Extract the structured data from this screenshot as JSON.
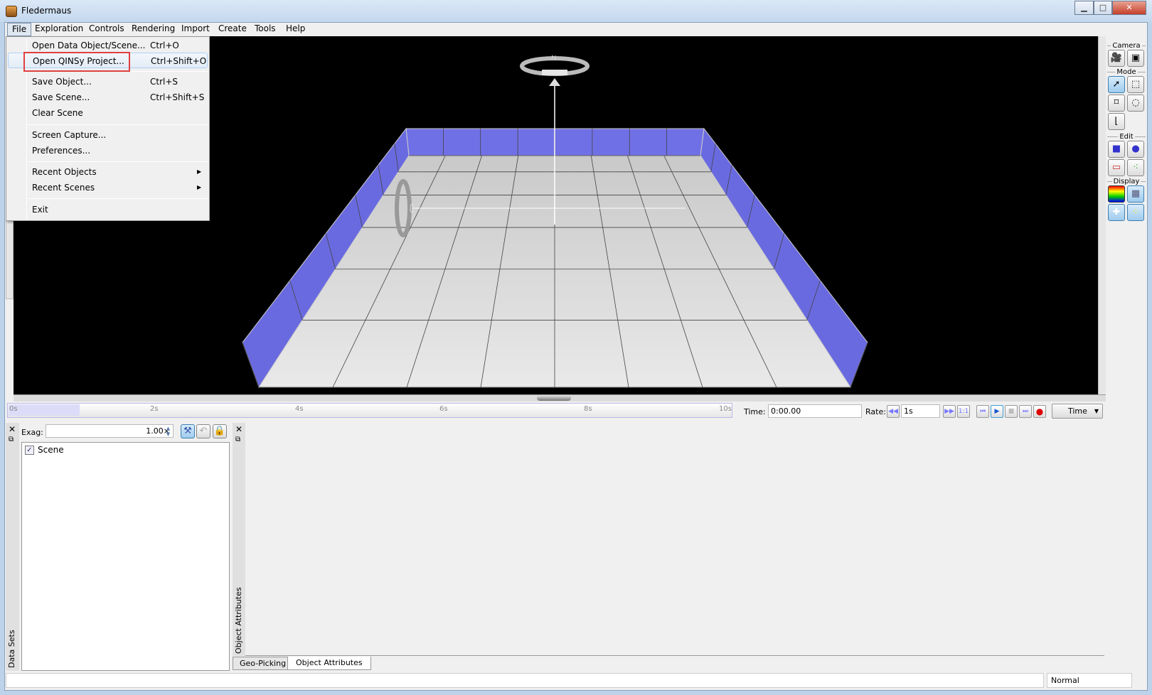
{
  "window": {
    "title": "Fledermaus",
    "min": "▁",
    "max": "□",
    "close": "✕"
  },
  "menubar": [
    "File",
    "Exploration",
    "Controls",
    "Rendering",
    "Import",
    "Create",
    "Tools",
    "Help"
  ],
  "file_menu": [
    {
      "label": "Open Data Object/Scene...",
      "shortcut": "Ctrl+O"
    },
    {
      "label": "Open QINSy Project...",
      "shortcut": "Ctrl+Shift+O"
    },
    {
      "label": "Save Object...",
      "shortcut": "Ctrl+S"
    },
    {
      "label": "Save Scene...",
      "shortcut": "Ctrl+Shift+S"
    },
    {
      "label": "Clear Scene",
      "shortcut": ""
    },
    {
      "label": "Screen Capture...",
      "shortcut": ""
    },
    {
      "label": "Preferences...",
      "shortcut": ""
    },
    {
      "label": "Recent Objects",
      "shortcut": "",
      "arrow": "▶"
    },
    {
      "label": "Recent Scenes",
      "shortcut": "",
      "arrow": "▶"
    },
    {
      "label": "Exit",
      "shortcut": ""
    }
  ],
  "scene": {
    "compass_label": "N",
    "wall_color": "#6f6fe8",
    "floor_color": "#d8d8d8"
  },
  "toolbar": {
    "camera": "Camera",
    "mode": "Mode",
    "edit": "Edit",
    "display": "Display"
  },
  "timeline": {
    "ticks": [
      "0s",
      "2s",
      "4s",
      "6s",
      "8s",
      "10s"
    ],
    "time_label": "Time:",
    "time_value": "0:00.00",
    "rate_label": "Rate:",
    "rate_value": "1s",
    "one_to_one": "1:1",
    "mode_select": "Time"
  },
  "datasets": {
    "exag_label": "Exag:",
    "exag_value": "1.00×",
    "scene_item": "Scene",
    "scene_checked": true,
    "panel_title": "Data Sets"
  },
  "attributes": {
    "panel_title": "Object Attributes",
    "tabs": [
      "Geo-Picking",
      "Object Attributes"
    ]
  },
  "status": {
    "mode": "Normal"
  }
}
